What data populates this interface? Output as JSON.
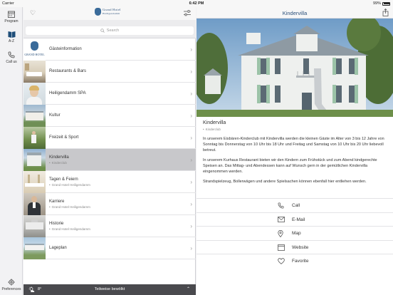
{
  "status_bar": {
    "carrier": "Carrier",
    "time": "6:42 PM",
    "battery": "99%"
  },
  "rail": [
    {
      "label": "Program",
      "icon": "calendar-icon"
    },
    {
      "label": "A-Z",
      "icon": "book-icon"
    },
    {
      "label": "Call us",
      "icon": "phone-icon"
    },
    {
      "label": "Preferences",
      "icon": "gear-icon"
    }
  ],
  "list_header": {
    "logo_line1": "Grand Hotel",
    "logo_line2": "Heiligendamm"
  },
  "search": {
    "placeholder": "Search"
  },
  "list": [
    {
      "title": "Gästeinformation",
      "sub": "",
      "logo_text": "GRAND HOTEL"
    },
    {
      "title": "Restaurants & Bars",
      "sub": ""
    },
    {
      "title": "Heiligendamm SPA",
      "sub": ""
    },
    {
      "title": "Kultur",
      "sub": ""
    },
    {
      "title": "Freizeit & Sport",
      "sub": ""
    },
    {
      "title": "Kindervilla",
      "sub": "Kinderclub"
    },
    {
      "title": "Tagen & Feiern",
      "sub": "Grand Hotel Heiligendamm"
    },
    {
      "title": "Karriere",
      "sub": "Grand Hotel Heiligendamm"
    },
    {
      "title": "Historie",
      "sub": "Grand Hotel Heiligendamm"
    },
    {
      "title": "Lageplan",
      "sub": ""
    }
  ],
  "weather": {
    "temp": "8°",
    "condition": "Teilweise bewölkt"
  },
  "detail": {
    "header_title": "Kindervilla",
    "title": "Kindervilla",
    "category": "Kinderclub",
    "paragraphs": [
      "In unserem Eisbären-Kinderclub mit Kindervilla werden die kleinen Gäste im Alter von 3 bis 12 Jahre von Sonntag bis Donnerstag von 10 Uhr bis 18 Uhr und Freitag und Samstag von 10 Uhr bis 20 Uhr liebevoll betreut.",
      "In unserem Kurhaus Restaurant bieten wir den Kindern zum Frühstück und zum Abend kindgerechte Speisen an. Das Mittag- und Abendessen kann auf Wunsch gern in der gemütlichen Kindervilla eingenommen werden.",
      "Strandspielzeug, Bollerwägen und andere Spielsachen können ebenfall hier entliehen werden."
    ],
    "actions": [
      {
        "label": "Call",
        "icon": "phone-icon"
      },
      {
        "label": "E-Mail",
        "icon": "mail-icon"
      },
      {
        "label": "Map",
        "icon": "map-pin-icon"
      },
      {
        "label": "Website",
        "icon": "browser-icon"
      },
      {
        "label": "Favorite",
        "icon": "heart-icon"
      }
    ]
  },
  "colors": {
    "accent": "#2a4f7a",
    "selected_row": "#c8c8cb",
    "weather_bar": "#4a4a4e"
  }
}
